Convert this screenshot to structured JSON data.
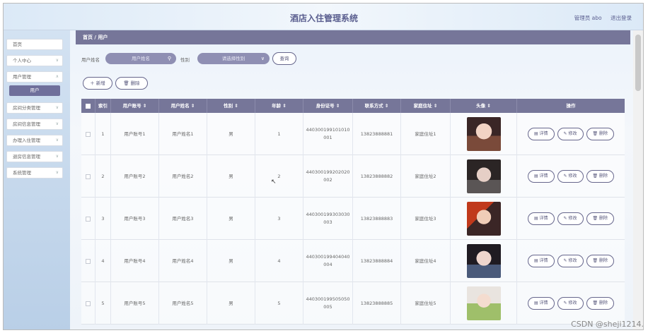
{
  "header": {
    "title": "酒店入住管理系统",
    "admin": "管理员 abo",
    "logout": "退出登录"
  },
  "sidebar": {
    "items": [
      {
        "label": "首页",
        "chevron": false
      },
      {
        "label": "个人中心",
        "chevron": true
      },
      {
        "label": "用户管理",
        "chevron": true
      },
      {
        "label": "房间分类管理",
        "chevron": true
      },
      {
        "label": "房间信息管理",
        "chevron": true
      },
      {
        "label": "办理入住管理",
        "chevron": true
      },
      {
        "label": "退房信息管理",
        "chevron": true
      },
      {
        "label": "系统管理",
        "chevron": true
      }
    ],
    "active_sub": "用户"
  },
  "breadcrumb": "首页 / 用户",
  "filters": {
    "name_label": "用户姓名",
    "name_placeholder": "用户姓名",
    "gender_label": "性别",
    "gender_placeholder": "请选择性别",
    "query_button": "查询"
  },
  "toolbar": {
    "add_button": "新增",
    "delete_button": "删除"
  },
  "table": {
    "columns": [
      "",
      "索引",
      "用户账号 ⇕",
      "用户姓名 ⇕",
      "性别 ⇕",
      "年龄 ⇕",
      "身份证号 ⇕",
      "联系方式 ⇕",
      "家庭住址 ⇕",
      "头像 ⇕",
      "操作"
    ],
    "rows": [
      {
        "index": "1",
        "account": "用户账号1",
        "name": "用户姓名1",
        "gender": "男",
        "age": "1",
        "id_line1": "440300199101010",
        "id_line2": "001",
        "phone": "13823888881",
        "address": "家庭住址1"
      },
      {
        "index": "2",
        "account": "用户账号2",
        "name": "用户姓名2",
        "gender": "男",
        "age": "2",
        "id_line1": "440300199202020",
        "id_line2": "002",
        "phone": "13823888882",
        "address": "家庭住址2"
      },
      {
        "index": "3",
        "account": "用户账号3",
        "name": "用户姓名3",
        "gender": "男",
        "age": "3",
        "id_line1": "440300199303030",
        "id_line2": "003",
        "phone": "13823888883",
        "address": "家庭住址3"
      },
      {
        "index": "4",
        "account": "用户账号4",
        "name": "用户姓名4",
        "gender": "男",
        "age": "4",
        "id_line1": "440300199404040",
        "id_line2": "004",
        "phone": "13823888884",
        "address": "家庭住址4"
      },
      {
        "index": "5",
        "account": "用户账号5",
        "name": "用户姓名5",
        "gender": "男",
        "age": "5",
        "id_line1": "440300199505050",
        "id_line2": "005",
        "phone": "13823888885",
        "address": "家庭住址5"
      }
    ],
    "actions": {
      "detail": "详情",
      "edit": "修改",
      "delete": "删除"
    }
  },
  "watermark": "CSDN @sheji1214.",
  "colors": {
    "accent": "#767699",
    "header_text": "#5a5e8f"
  }
}
